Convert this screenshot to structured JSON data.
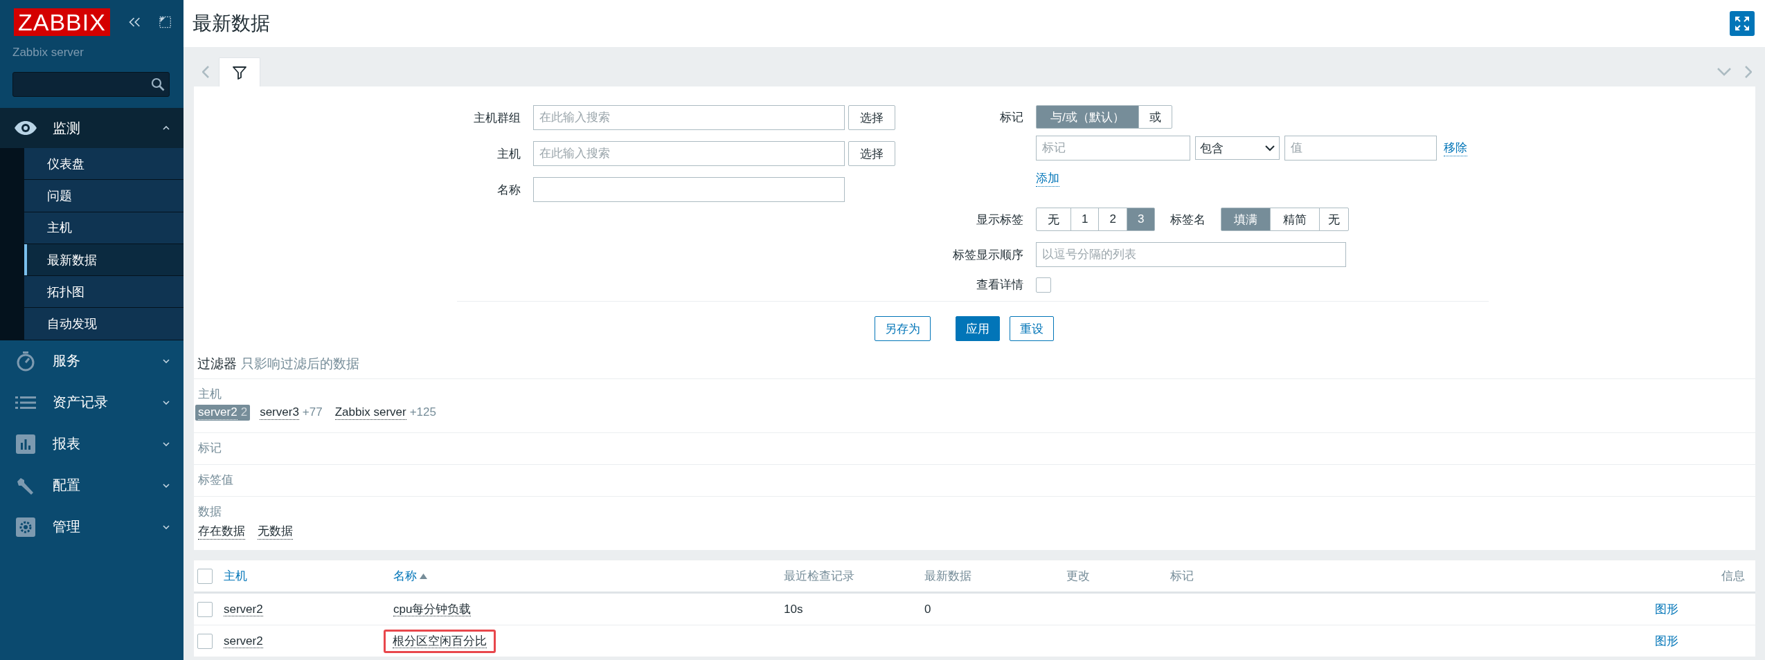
{
  "sidebar": {
    "logo": "ZABBIX",
    "server": "Zabbix server",
    "menu": [
      {
        "label": "监测",
        "expanded": true,
        "children": [
          {
            "label": "仪表盘",
            "selected": false
          },
          {
            "label": "问题",
            "selected": false
          },
          {
            "label": "主机",
            "selected": false
          },
          {
            "label": "最新数据",
            "selected": true
          },
          {
            "label": "拓扑图",
            "selected": false
          },
          {
            "label": "自动发现",
            "selected": false
          }
        ]
      },
      {
        "label": "服务",
        "expanded": false
      },
      {
        "label": "资产记录",
        "expanded": false
      },
      {
        "label": "报表",
        "expanded": false
      },
      {
        "label": "配置",
        "expanded": false
      },
      {
        "label": "管理",
        "expanded": false
      }
    ]
  },
  "page": {
    "title": "最新数据"
  },
  "filter": {
    "tab_selected": true,
    "fields": [
      {
        "label": "主机群组",
        "placeholder": "在此输入搜索",
        "button": "选择"
      },
      {
        "label": "主机",
        "placeholder": "在此输入搜索",
        "button": "选择"
      },
      {
        "label": "名称"
      }
    ],
    "tags": {
      "label": "标记",
      "operators": [
        {
          "label": "与/或（默认）",
          "selected": true
        },
        {
          "label": "或",
          "selected": false
        }
      ],
      "rows": [
        {
          "tag_placeholder": "标记",
          "operator": "包含",
          "value_placeholder": "值",
          "remove": "移除"
        }
      ],
      "add": "添加"
    },
    "show_tags": {
      "label": "显示标签",
      "options": [
        {
          "label": "无",
          "selected": false
        },
        {
          "label": "1",
          "selected": false
        },
        {
          "label": "2",
          "selected": false
        },
        {
          "label": "3",
          "selected": true
        }
      ]
    },
    "tag_name": {
      "label": "标签名",
      "options": [
        {
          "label": "填满",
          "selected": true
        },
        {
          "label": "精简",
          "selected": false
        },
        {
          "label": "无",
          "selected": false
        }
      ]
    },
    "tag_order": {
      "label": "标签显示顺序",
      "placeholder": "以逗号分隔的列表"
    },
    "details": {
      "label": "查看详情",
      "checked": false
    },
    "buttons": [
      {
        "label": "另存为",
        "kind": "secondary"
      },
      {
        "label": "应用",
        "kind": "primary"
      },
      {
        "label": "重设",
        "kind": "secondary"
      }
    ]
  },
  "summary": {
    "title": "过滤器",
    "subtitle": "只影响过滤后的数据",
    "sections": [
      {
        "label": "主机",
        "values": [
          {
            "name": "server2",
            "count": "2",
            "selected": true
          },
          {
            "name": "server3",
            "count": "+77",
            "selected": false
          },
          {
            "name": "Zabbix server",
            "count": "+125",
            "selected": false
          }
        ]
      },
      {
        "label": "标记"
      },
      {
        "label": "标签值"
      },
      {
        "label": "数据",
        "values": [
          {
            "name": "存在数据",
            "selected": false
          },
          {
            "name": "无数据",
            "selected": false
          }
        ]
      }
    ]
  },
  "table": {
    "all_checked": false,
    "columns": [
      {
        "label": "主机",
        "kind": "link",
        "sorted": false
      },
      {
        "label": "名称",
        "kind": "link",
        "sorted": true
      },
      {
        "label": "最近检查记录",
        "kind": "plain",
        "sorted": false
      },
      {
        "label": "最新数据",
        "kind": "plain",
        "sorted": false
      },
      {
        "label": "更改",
        "kind": "plain",
        "sorted": false
      },
      {
        "label": "标记",
        "kind": "plain",
        "sorted": false
      },
      {
        "label": "信息",
        "kind": "plain",
        "sorted": false
      }
    ],
    "rows": [
      {
        "checked": false,
        "host": "server2",
        "name": "cpu每分钟负载",
        "last_check": "10s",
        "latest": "0",
        "info": "图形",
        "highlighted": false
      },
      {
        "checked": false,
        "host": "server2",
        "name": "根分区空闲百分比",
        "info": "图形",
        "highlighted": true
      }
    ]
  }
}
